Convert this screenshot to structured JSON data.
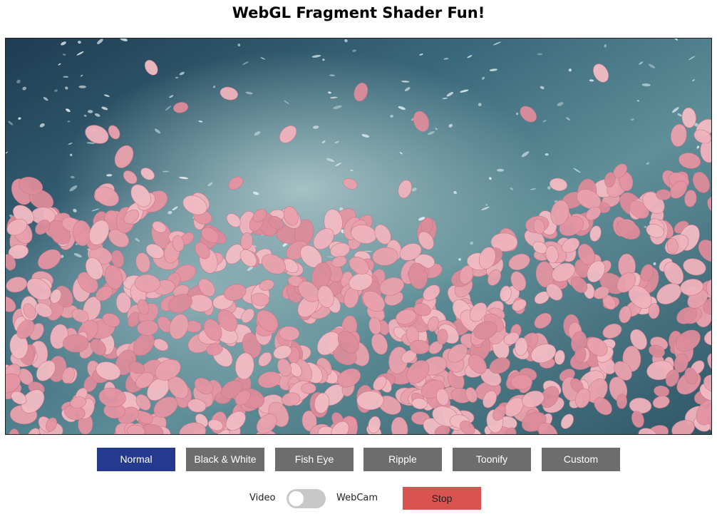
{
  "page": {
    "title": "WebGL Fragment Shader Fun!"
  },
  "canvas": {
    "content": "video frame: pink petals floating on rippling blue water"
  },
  "effects": {
    "buttons": [
      {
        "label": "Normal",
        "active": true
      },
      {
        "label": "Black & White",
        "active": false
      },
      {
        "label": "Fish Eye",
        "active": false
      },
      {
        "label": "Ripple",
        "active": false
      },
      {
        "label": "Toonify",
        "active": false
      },
      {
        "label": "Custom",
        "active": false
      }
    ]
  },
  "source": {
    "video_label": "Video",
    "webcam_label": "WebCam",
    "toggle_on": false,
    "stop_label": "Stop"
  },
  "colors": {
    "active_button": "#253a8e",
    "inactive_button": "#6d6d6d",
    "stop_button": "#d9534f",
    "toggle_track": "#c8c8c8"
  }
}
